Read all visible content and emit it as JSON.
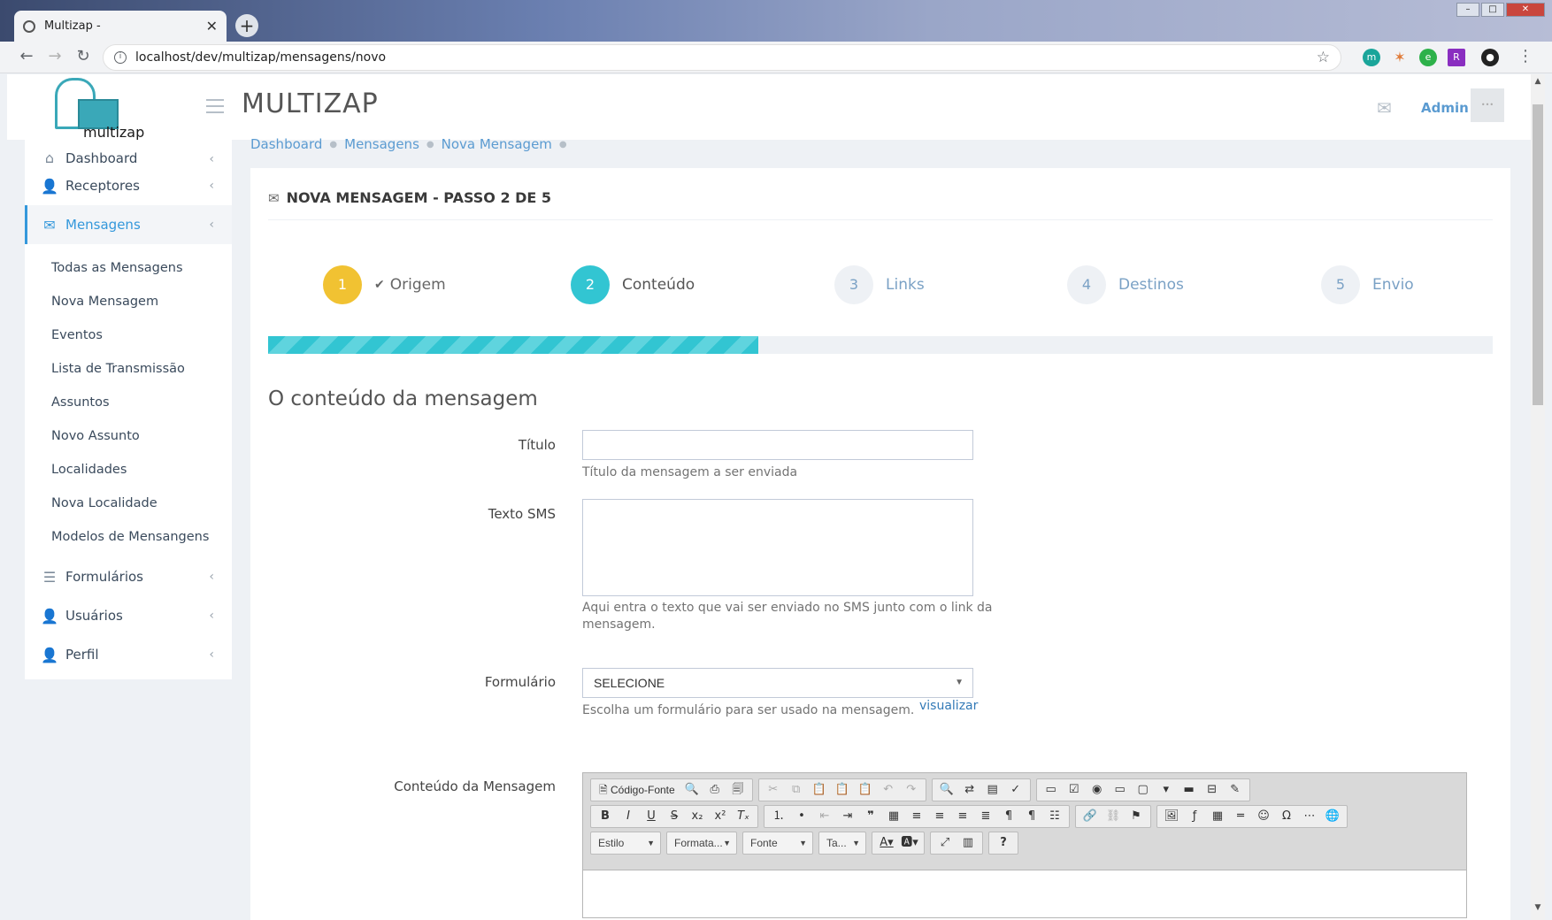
{
  "browser": {
    "tab_title": "Multizap -",
    "url": "localhost/dev/multizap/mensagens/novo"
  },
  "header": {
    "logo_text": "multizap",
    "app_title": "MULTIZAP",
    "user_name": "Admin"
  },
  "sidebar": {
    "items": [
      {
        "label": "Dashboard",
        "icon": "home-icon"
      },
      {
        "label": "Receptores",
        "icon": "user-icon"
      },
      {
        "label": "Mensagens",
        "icon": "envelope-icon"
      },
      {
        "label": "Formulários",
        "icon": "list-icon"
      },
      {
        "label": "Usuários",
        "icon": "user-icon"
      },
      {
        "label": "Perfil",
        "icon": "user-icon"
      }
    ],
    "submenu": [
      "Todas as Mensagens",
      "Nova Mensagem",
      "Eventos",
      "Lista de Transmissão",
      "Assuntos",
      "Novo Assunto",
      "Localidades",
      "Nova Localidade",
      "Modelos de Mensangens"
    ]
  },
  "breadcrumb": [
    "Dashboard",
    "Mensagens",
    "Nova Mensagem"
  ],
  "page": {
    "title": "NOVA MENSAGEM - PASSO 2 DE 5",
    "progress_percent": 40,
    "steps": [
      {
        "number": "1",
        "label": "Origem"
      },
      {
        "number": "2",
        "label": "Conteúdo"
      },
      {
        "number": "3",
        "label": "Links"
      },
      {
        "number": "4",
        "label": "Destinos"
      },
      {
        "number": "5",
        "label": "Envio"
      }
    ],
    "section_title": "O conteúdo da mensagem"
  },
  "form": {
    "titulo_label": "Título",
    "titulo_value": "",
    "titulo_help": "Título da mensagem a ser enviada",
    "sms_label": "Texto SMS",
    "sms_value": "",
    "sms_help_line1": "Aqui entra o texto que vai ser enviado no SMS junto com o link da",
    "sms_help_line2": "mensagem.",
    "formulario_label": "Formulário",
    "formulario_value": "SELECIONE",
    "formulario_help": "Escolha um formulário para ser usado na mensagem.",
    "visualizar_link": "visualizar",
    "conteudo_label": "Conteúdo da Mensagem"
  },
  "editor": {
    "source_button": "Código-Fonte",
    "combo_style": "Estilo",
    "combo_format": "Formata...",
    "combo_font": "Fonte",
    "combo_size": "Ta..."
  }
}
